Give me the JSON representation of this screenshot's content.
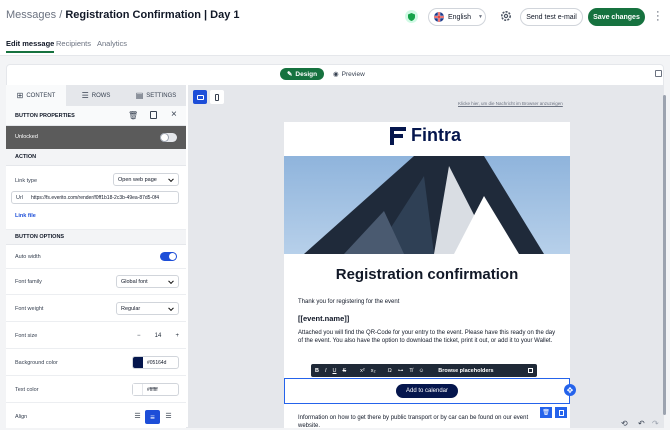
{
  "header": {
    "crumb_parent": "Messages",
    "crumb_sep": " / ",
    "title": "Registration Confirmation | Day 1",
    "language": "English",
    "send_test_label": "Send test e-mail",
    "save_label": "Save changes"
  },
  "tabs": [
    "Edit message",
    "Recipients",
    "Analytics"
  ],
  "mode": {
    "design": "Design",
    "preview": "Preview"
  },
  "sidebar": {
    "tabs": [
      "CONTENT",
      "ROWS",
      "SETTINGS"
    ],
    "properties_title": "BUTTON PROPERTIES",
    "lock_label": "Unlocked",
    "action_title": "ACTION",
    "link_type_label": "Link type",
    "link_type_value": "Open web page",
    "url_label": "Url",
    "url_value": "https://fs.everito.com/render/f0ff1b18-2c3b-49ea-87d5-0f4",
    "link_file": "Link file",
    "options_title": "BUTTON OPTIONS",
    "auto_width_label": "Auto width",
    "font_family_label": "Font family",
    "font_family_value": "Global font",
    "font_weight_label": "Font weight",
    "font_weight_value": "Regular",
    "font_size_label": "Font size",
    "font_size_minus": "−",
    "font_size_value": "14",
    "font_size_plus": "+",
    "bg_color_label": "Background color",
    "bg_color_value": "#05164d",
    "text_color_label": "Text color",
    "text_color_value": "#ffffff",
    "align_label": "Align"
  },
  "email": {
    "browser_link": "Klicke hier, um die Nachricht im Browser anzuzeigen",
    "brand": "Fintra",
    "heading": "Registration confirmation",
    "thanks": "Thank you for registering for the event",
    "placeholder_event": "[[event.name]]",
    "body": "Attached you will find the QR-Code for your entry to the event. Please have this ready on the day of the event. You also have the option to download the ticket, print it out, or add it to your Wallet.",
    "button": "Add to calendar",
    "info": "Information on how to get there by public transport or by car can be found on our event website.",
    "toolbar_placeholders": "Browse placeholders",
    "toolbar_items": [
      "B",
      "I",
      "U",
      "S",
      "x²",
      "x₂",
      "Ω",
      "⊶",
      "T̸",
      "☺"
    ]
  },
  "colors": {
    "accent": "#16723f",
    "brand": "#05164d",
    "selection": "#2563eb"
  }
}
